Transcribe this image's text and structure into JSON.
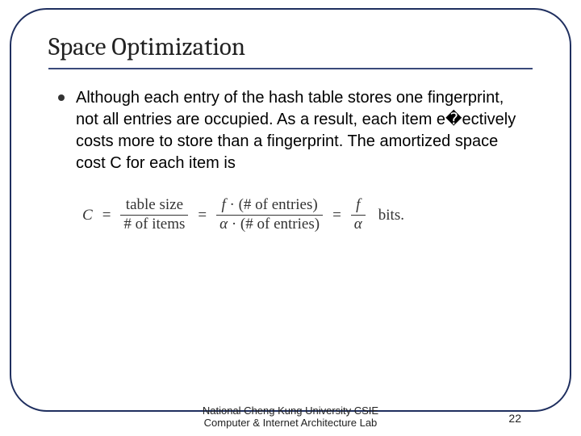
{
  "slide": {
    "title": "Space Optimization",
    "bullet1": "Although each entry of the hash table stores one ﬁngerprint, not all entries are occupied. As a result, each item e�ectively costs more to store than a ﬁngerprint. The amortized space cost C for each item is"
  },
  "formula": {
    "lhs": "C",
    "eq": "=",
    "frac1_num": "table size",
    "frac1_den": "# of items",
    "frac2_num_f": "f",
    "frac2_num_dot": " · (# of entries)",
    "frac2_den_a": "α",
    "frac2_den_dot": " · (# of entries)",
    "frac3_num": "f",
    "frac3_den": "α",
    "units": "bits."
  },
  "footer": {
    "line1": "National Cheng Kung University CSIE",
    "line2": "Computer & Internet Architecture Lab",
    "page": "22"
  }
}
